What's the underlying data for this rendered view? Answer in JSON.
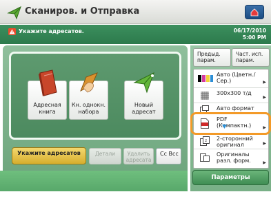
{
  "header": {
    "title": "Сканиров. и Отправка"
  },
  "status": {
    "message": "Укажите адресатов.",
    "date": "06/17/2010",
    "time": "5:00 PM"
  },
  "addressing": {
    "buttons": [
      {
        "label": "Адресная книга",
        "icon": "address-book-icon"
      },
      {
        "label": "Кн. однокн. набора",
        "icon": "hand-pointer-icon"
      },
      {
        "label": "Новый адресат",
        "icon": "paper-plane-icon"
      }
    ],
    "specify_label": "Укажите адресатов",
    "details_label": "Детали",
    "delete_label": "Удалить адресата",
    "cc_label": "Cc Bcc"
  },
  "settings": {
    "prev_label": "Предыд. парам.",
    "fav_label": "Част. исп. парам.",
    "color_mode": "Авто (Цветн./Сер.)",
    "resolution": "300x300 т/д",
    "format_label": "Авто формат",
    "file_format": "PDF (Компактн.)",
    "duplex": "2-сторонний оригинал",
    "original_type": "Оригиналы разл. форм.",
    "params_label": "Параметры"
  },
  "colors": {
    "status_green": "#2c7a4c",
    "highlight": "#f39a28",
    "specify_button": "#e2bd45"
  }
}
